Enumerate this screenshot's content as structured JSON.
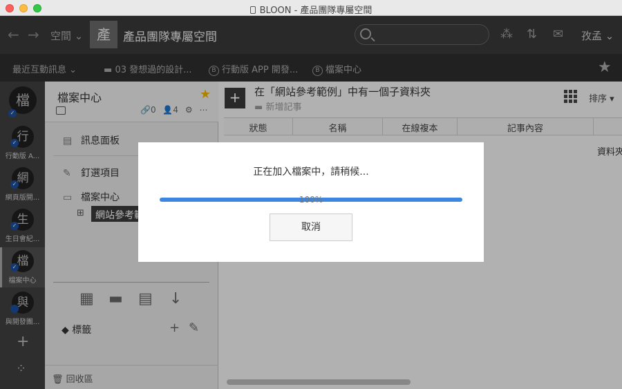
{
  "window": {
    "title": "BLOON - 產品團隊專屬空間"
  },
  "topbar": {
    "space_dropdown": "空間",
    "space_avatar": "產",
    "space_name": "產品團隊專屬空間",
    "user_name": "孜孟"
  },
  "navbar": {
    "recent": "最近互動訊息",
    "items": [
      "03 發想過的設計...",
      "行動版 APP 開發...",
      "檔案中心"
    ],
    "badge": "B"
  },
  "spaces": [
    {
      "avatar": "檔",
      "label": ""
    },
    {
      "avatar": "行",
      "label": "行動版 A..."
    },
    {
      "avatar": "網",
      "label": "網頁版開..."
    },
    {
      "avatar": "生",
      "label": "生日會紀..."
    },
    {
      "avatar": "檔",
      "label": "檔案中心"
    },
    {
      "avatar": "與",
      "label": "與開發團..."
    }
  ],
  "panel": {
    "title": "檔案中心",
    "link_count": "0",
    "member_count": "4",
    "message_board": "訊息面板",
    "pinned": "釘選項目",
    "file_center": "檔案中心",
    "subfolder": "網站參考範例",
    "tags": "標籤",
    "trash": "回收區"
  },
  "main": {
    "title": "在「網站參考範例」中有一個子資料夾",
    "add_note": "新增記事",
    "sort": "排序",
    "columns": [
      "狀態",
      "名稱",
      "在線複本",
      "記事內容"
    ],
    "row_type": "資料夾"
  },
  "dialog": {
    "message": "正在加入檔案中，請稍候...",
    "progress": 1.0,
    "progress_text": "100%",
    "cancel": "取消"
  },
  "colors": {
    "accent": "#3a86e0",
    "star": "#f0b400",
    "check": "#1d4f9e"
  }
}
